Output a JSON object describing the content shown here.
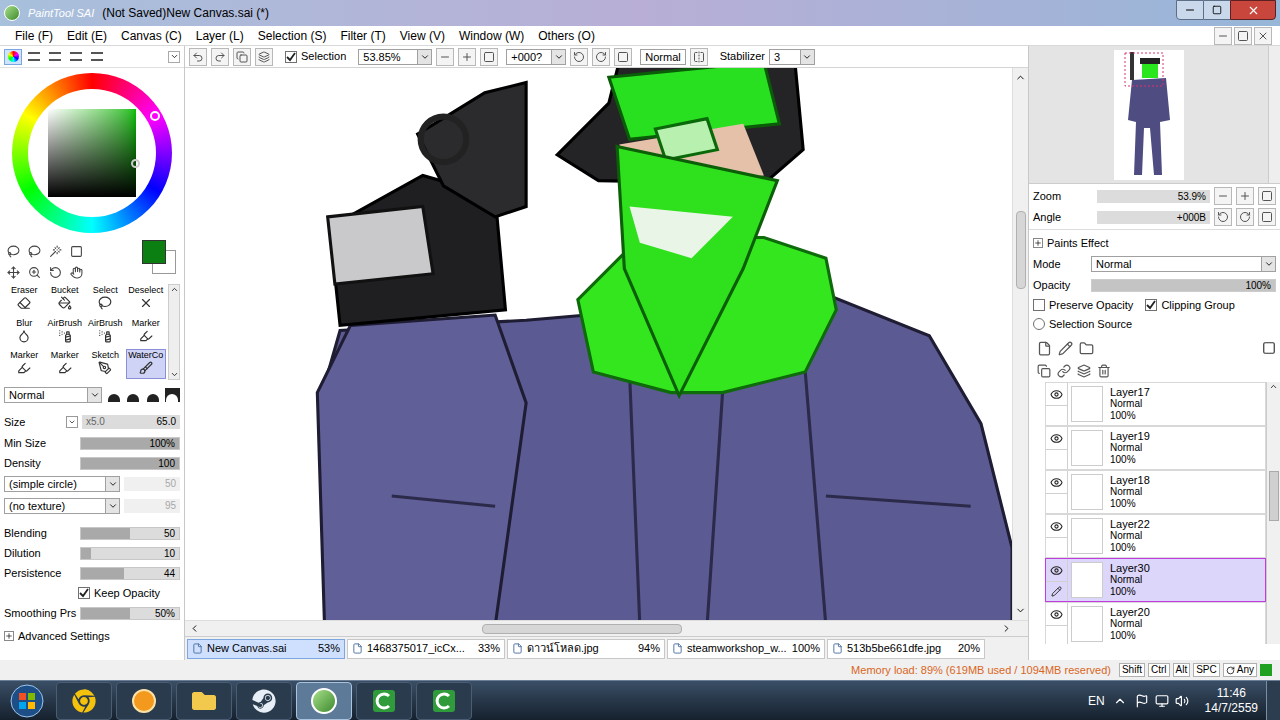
{
  "window": {
    "app": "PaintTool SAI",
    "title": "(Not Saved)New Canvas.sai (*)"
  },
  "menu": [
    "File (F)",
    "Edit (E)",
    "Canvas (C)",
    "Layer (L)",
    "Selection (S)",
    "Filter (T)",
    "View (V)",
    "Window (W)",
    "Others (O)"
  ],
  "toolbar": {
    "selection": {
      "label": "Selection",
      "checked": true
    },
    "zoom": "53.85%",
    "angle": "+000?",
    "blend": "Normal",
    "stabilizer": {
      "label": "Stabilizer",
      "value": "3"
    }
  },
  "color_modes": [
    {
      "selected": true
    },
    {
      "selected": false
    },
    {
      "selected": false
    },
    {
      "selected": false
    },
    {
      "selected": false
    }
  ],
  "tools": [
    {
      "label": "Eraser",
      "selected": false
    },
    {
      "label": "Bucket",
      "selected": false
    },
    {
      "label": "Select",
      "selected": false
    },
    {
      "label": "Deselect",
      "selected": false
    },
    {
      "label": "Blur",
      "selected": false
    },
    {
      "label": "AirBrush",
      "selected": false
    },
    {
      "label": "AirBrush",
      "selected": false
    },
    {
      "label": "Marker",
      "selected": false
    },
    {
      "label": "Marker",
      "selected": false
    },
    {
      "label": "Marker",
      "selected": false
    },
    {
      "label": "Sketch",
      "selected": false
    },
    {
      "label": "WaterCo",
      "selected": true
    }
  ],
  "brush": {
    "mode": "Normal",
    "size": {
      "label": "Size",
      "multiplier": "x5.0",
      "value": "65.0"
    },
    "bars": [
      {
        "label": "Min Size",
        "value": "100%",
        "level": 1
      },
      {
        "label": "Density",
        "value": "100",
        "level": 1
      }
    ],
    "shape": {
      "value": "(simple circle)",
      "amount": "50",
      "disabled": true
    },
    "texture": {
      "value": "(no texture)",
      "amount": "95",
      "disabled": true
    },
    "mix": [
      {
        "label": "Blending",
        "value": "50",
        "level": 0.5
      },
      {
        "label": "Dilution",
        "value": "10",
        "level": 0.1
      },
      {
        "label": "Persistence",
        "value": "44",
        "level": 0.44
      }
    ],
    "keep_opacity": {
      "label": "Keep Opacity",
      "checked": true
    },
    "smoothing": {
      "label": "Smoothing Prs",
      "value": "50%",
      "level": 0.5
    },
    "advanced": "Advanced Settings"
  },
  "navigator": {
    "zoom": {
      "label": "Zoom",
      "value": "53.9%"
    },
    "angle": {
      "label": "Angle",
      "value": "+000B"
    }
  },
  "layer_panel": {
    "title": "Paints Effect",
    "mode": {
      "label": "Mode",
      "value": "Normal"
    },
    "opacity": {
      "label": "Opacity",
      "value": "100%",
      "level": 1
    },
    "preserve_opacity": {
      "label": "Preserve Opacity",
      "checked": false
    },
    "clipping_group": {
      "label": "Clipping Group",
      "checked": true
    },
    "selection_source": {
      "label": "Selection Source",
      "checked": false
    }
  },
  "layers": [
    {
      "name": "Layer17",
      "mode": "Normal",
      "opacity": "100%",
      "visible": true,
      "selected": false
    },
    {
      "name": "Layer19",
      "mode": "Normal",
      "opacity": "100%",
      "visible": true,
      "selected": false
    },
    {
      "name": "Layer18",
      "mode": "Normal",
      "opacity": "100%",
      "visible": true,
      "selected": false
    },
    {
      "name": "Layer22",
      "mode": "Normal",
      "opacity": "100%",
      "visible": true,
      "selected": false
    },
    {
      "name": "Layer30",
      "mode": "Normal",
      "opacity": "100%",
      "visible": true,
      "selected": true
    },
    {
      "name": "Layer20",
      "mode": "Normal",
      "opacity": "100%",
      "visible": true,
      "selected": false
    }
  ],
  "file_tabs": [
    {
      "label": "New Canvas.sai",
      "zoom": "53%",
      "selected": true
    },
    {
      "label": "1468375017_icCx...",
      "zoom": "33%",
      "selected": false
    },
    {
      "label": "ดาวน์โหลด.jpg",
      "zoom": "94%",
      "selected": false
    },
    {
      "label": "steamworkshop_w...",
      "zoom": "100%",
      "selected": false
    },
    {
      "label": "513b5be661dfe.jpg",
      "zoom": "20%",
      "selected": false
    }
  ],
  "status": {
    "memory": "Memory load: 89% (619MB used / 1094MB reserved)",
    "keys": [
      "Shift",
      "Ctrl",
      "Alt",
      "SPC",
      "Any"
    ]
  },
  "taskbar": {
    "apps": [
      {
        "selected": false
      },
      {
        "selected": false
      },
      {
        "selected": false
      },
      {
        "selected": false
      },
      {
        "selected": true
      },
      {
        "selected": false
      },
      {
        "selected": false
      }
    ],
    "lang": "EN",
    "time": "11:46",
    "date": "14/7/2559"
  }
}
